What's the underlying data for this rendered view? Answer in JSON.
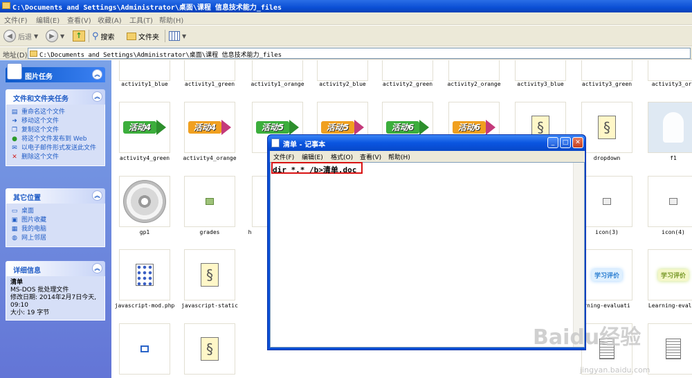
{
  "window": {
    "title": "C:\\Documents and Settings\\Administrator\\桌面\\课程 信息技术能力_files"
  },
  "menu": [
    "文件(F)",
    "编辑(E)",
    "查看(V)",
    "收藏(A)",
    "工具(T)",
    "帮助(H)"
  ],
  "toolbar": {
    "back": "后退",
    "search": "搜索",
    "folders": "文件夹"
  },
  "address": {
    "label": "地址(D)",
    "path": "C:\\Documents and Settings\\Administrator\\桌面\\课程 信息技术能力_files"
  },
  "left": {
    "picture_tasks": "图片任务",
    "file_tasks": {
      "title": "文件和文件夹任务",
      "items": [
        {
          "label": "重命名这个文件",
          "icon": "rename-icon"
        },
        {
          "label": "移动这个文件",
          "icon": "move-icon"
        },
        {
          "label": "复制这个文件",
          "icon": "copy-icon"
        },
        {
          "label": "将这个文件发布到 Web",
          "icon": "web-publish-icon"
        },
        {
          "label": "以电子邮件形式发送此文件",
          "icon": "email-icon"
        },
        {
          "label": "删除这个文件",
          "icon": "delete-icon"
        }
      ]
    },
    "other_places": {
      "title": "其它位置",
      "items": [
        {
          "label": "桌面",
          "icon": "desktop-icon"
        },
        {
          "label": "图片收藏",
          "icon": "pictures-folder-icon"
        },
        {
          "label": "我的电脑",
          "icon": "my-computer-icon"
        },
        {
          "label": "网上邻居",
          "icon": "network-icon"
        }
      ]
    },
    "details": {
      "title": "详细信息",
      "name": "清单",
      "type": "MS-DOS 批处理文件",
      "modified": "修改日期: 2014年2月7日今天, 09:10",
      "size": "大小: 19 字节"
    }
  },
  "files": {
    "row1": [
      "activity1_blue",
      "activity1_green",
      "activity1_orange",
      "activity2_blue",
      "activity2_green",
      "activity2_orange",
      "activity3_blue",
      "activity3_green",
      "activity3_ora"
    ],
    "row2": [
      "activity4_green",
      "activity4_orange",
      "",
      "",
      "",
      "",
      "",
      "dropdown",
      "f1"
    ],
    "row3": [
      "gp1",
      "grades",
      "h",
      "",
      "",
      "",
      "",
      "icon(3)",
      "icon(4)"
    ],
    "row4": [
      "javascript-mod.php",
      "javascript-static",
      "",
      "",
      "",
      "",
      "",
      "rning-evaluati",
      "Learning-evalua"
    ],
    "activity_badges": [
      "活动4",
      "活动4",
      "活动5",
      "活动5",
      "活动6",
      "活动6"
    ],
    "eval_badge": "学习评价"
  },
  "notepad": {
    "title": "清单 - 记事本",
    "menu": [
      "文件(F)",
      "编辑(E)",
      "格式(O)",
      "查看(V)",
      "帮助(H)"
    ],
    "content": "dir *.* /b>清单.doc"
  },
  "watermark": {
    "brand": "Baidu经验",
    "url": "jingyan.baidu.com"
  }
}
